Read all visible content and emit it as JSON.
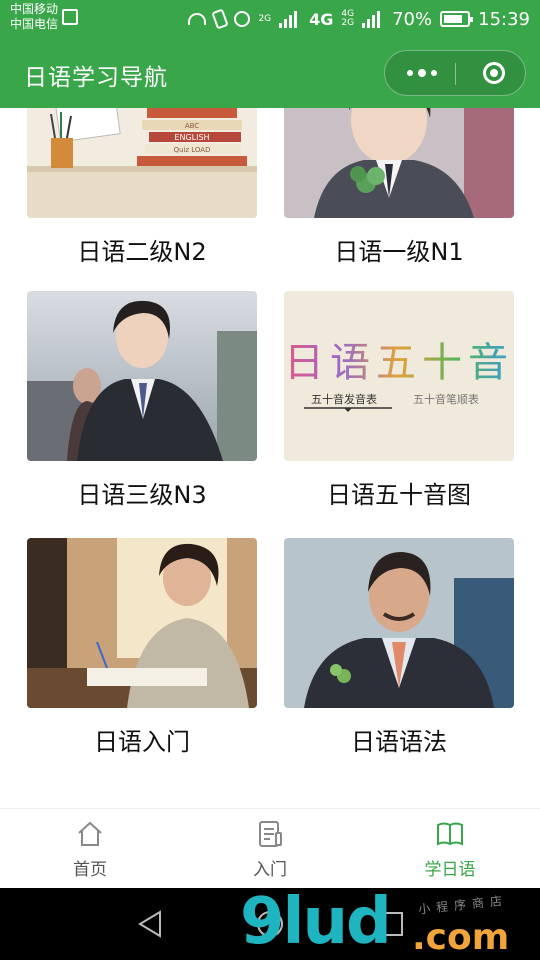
{
  "status_bar": {
    "carrier_1": "中国移动",
    "carrier_2": "中国电信",
    "net_small_top": "2G",
    "net_4g": "4G",
    "net_small_a": "4G",
    "net_small_b": "2G",
    "battery": "70%",
    "time": "15:39"
  },
  "navbar": {
    "title": "日语学习导航"
  },
  "grid": {
    "items": [
      {
        "label": "日语二级N2"
      },
      {
        "label": "日语一级N1"
      },
      {
        "label": "日语三级N3"
      },
      {
        "label": "日语五十音图"
      },
      {
        "label": "日语入门"
      },
      {
        "label": "日语语法"
      }
    ],
    "books_text": [
      "ENGLISH",
      "ABC",
      "Quiz LOAD"
    ],
    "gojuon": {
      "title": "日语五十音",
      "link_1": "五十音发音表",
      "link_2": "五十音笔顺表"
    }
  },
  "tabbar": {
    "tabs": [
      {
        "label": "首页",
        "icon": "home-icon"
      },
      {
        "label": "入门",
        "icon": "document-icon"
      },
      {
        "label": "学日语",
        "icon": "book-icon",
        "active": true
      }
    ]
  },
  "watermark": {
    "main": "9lud",
    "domain": ".com",
    "small": "小程序商店"
  },
  "colors": {
    "brand": "#3aa64a",
    "tab_inactive": "#555555",
    "tab_active": "#3aa64a"
  }
}
